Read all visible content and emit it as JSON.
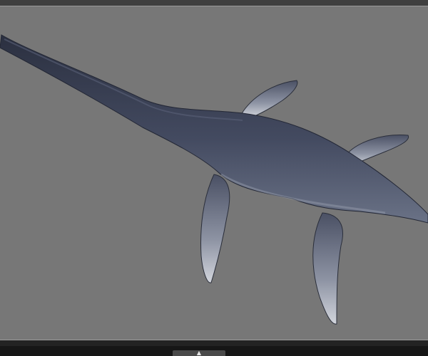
{
  "icons": {
    "panel_toggle": "chevron-up-icon"
  },
  "colors": {
    "viewport_background": "#777777",
    "model_body": "#3d4357",
    "model_fin_highlight": "#c8ccd4"
  }
}
